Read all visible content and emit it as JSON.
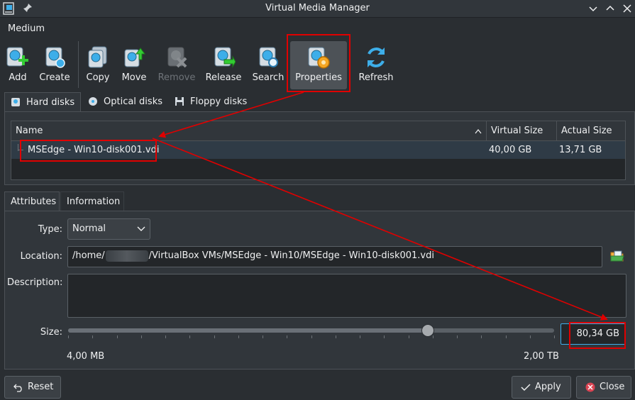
{
  "window": {
    "title": "Virtual Media Manager"
  },
  "menu": {
    "medium": "Medium"
  },
  "toolbar": {
    "add": "Add",
    "create": "Create",
    "copy": "Copy",
    "move": "Move",
    "remove": "Remove",
    "release": "Release",
    "search": "Search",
    "properties": "Properties",
    "refresh": "Refresh"
  },
  "tabs": {
    "hard_disks": "Hard disks",
    "optical_disks": "Optical disks",
    "floppy_disks": "Floppy disks"
  },
  "table": {
    "columns": {
      "name": "Name",
      "virtual_size": "Virtual Size",
      "actual_size": "Actual Size"
    },
    "rows": [
      {
        "name": "MSEdge - Win10-disk001.vdi",
        "virtual_size": "40,00 GB",
        "actual_size": "13,71 GB"
      }
    ]
  },
  "detail_tabs": {
    "attributes": "Attributes",
    "information": "Information"
  },
  "attributes": {
    "type_label": "Type:",
    "type_value": "Normal",
    "location_label": "Location:",
    "location_prefix": "/home/",
    "location_suffix": "/VirtualBox VMs/MSEdge - Win10/MSEdge - Win10-disk001.vdi",
    "description_label": "Description:",
    "description_value": "",
    "size_label": "Size:",
    "size_min": "4,00 MB",
    "size_max": "2,00 TB",
    "size_value": "80,34 GB",
    "size_slider_fraction": 0.74
  },
  "buttons": {
    "reset": "Reset",
    "apply": "Apply",
    "close": "Close"
  },
  "colors": {
    "accent": "#3daee9",
    "annotation": "#e00000",
    "background": "#2a2e32"
  }
}
